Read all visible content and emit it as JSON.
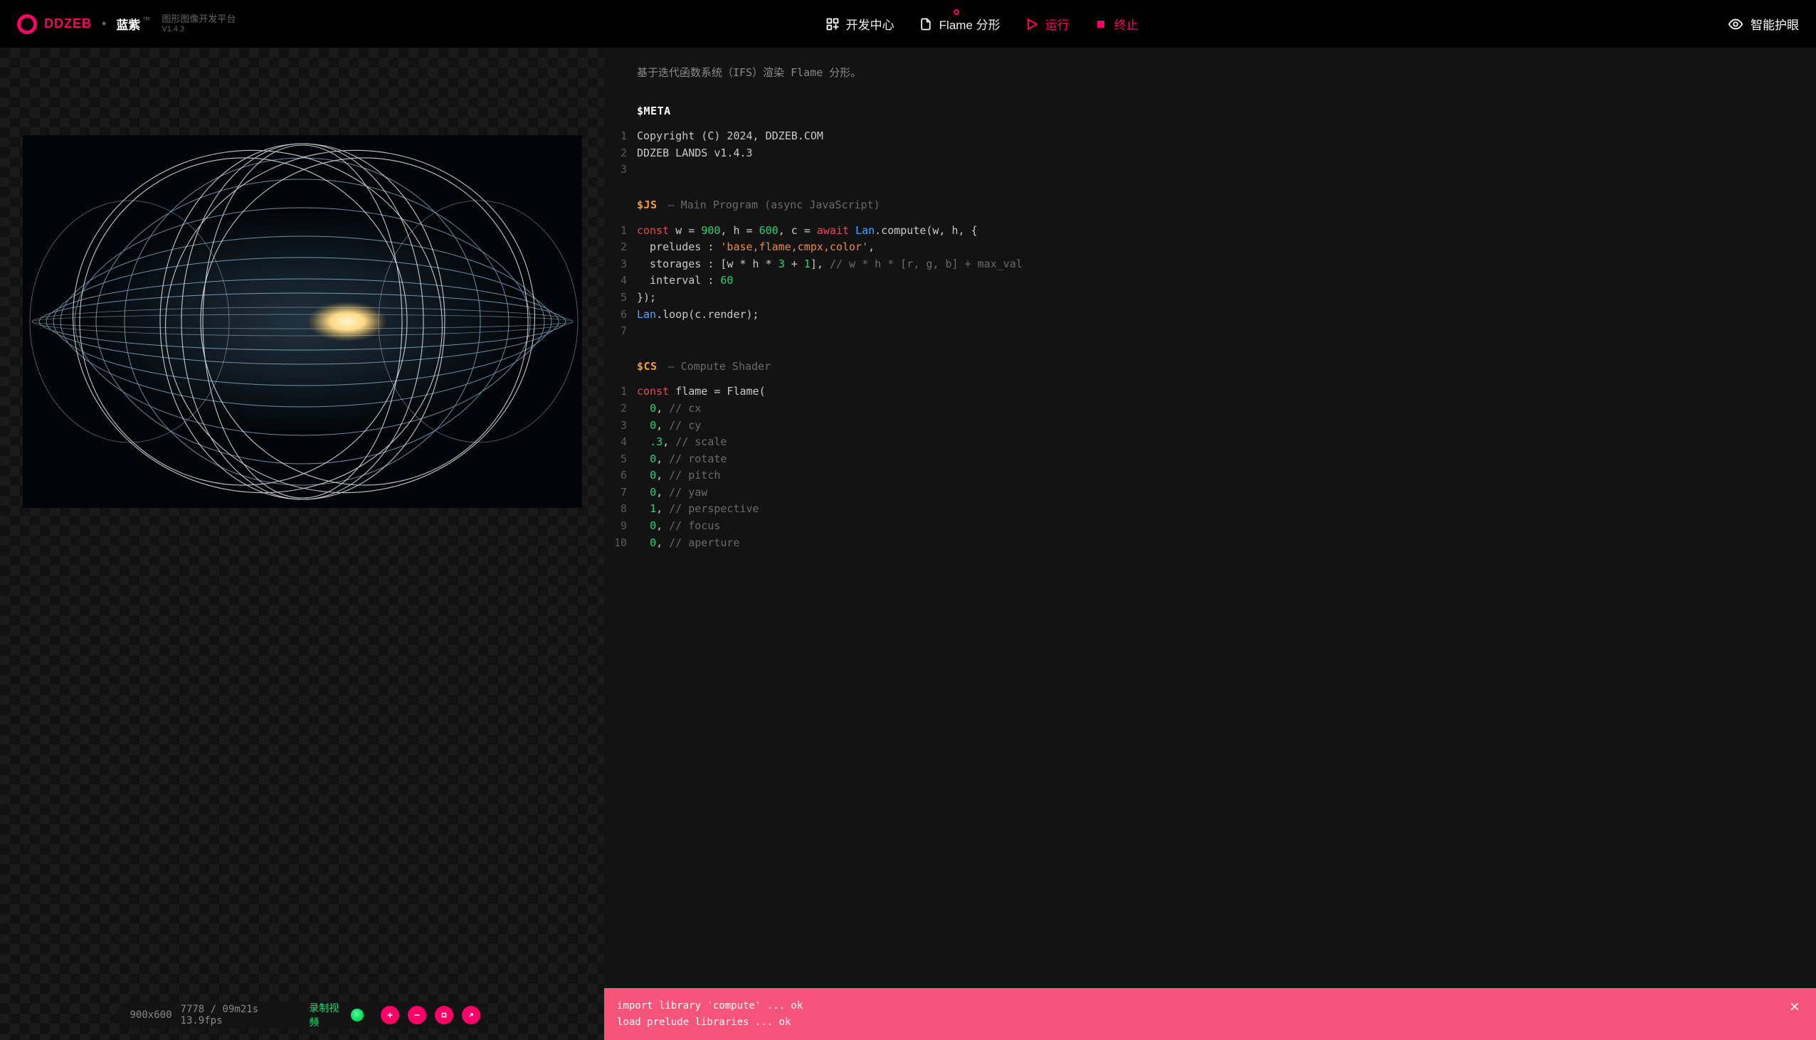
{
  "brand": {
    "name": "DDZEB",
    "sub_name": "蓝紫",
    "tm": "™",
    "desc": "图形图像开发平台",
    "version": "V1.4.3"
  },
  "header": {
    "dev_center": "开发中心",
    "file_label": "Flame 分形",
    "run": "运行",
    "stop": "终止",
    "eye_care": "智能护眼"
  },
  "status": {
    "resolution": "900x600",
    "frame": "7778",
    "time": "09m21s",
    "fps": "13.9fps",
    "record": "录制视频"
  },
  "editor": {
    "description": "基于迭代函数系统（IFS）渲染 Flame 分形。",
    "sections": {
      "meta": {
        "tag": "$META"
      },
      "js": {
        "tag": "$JS",
        "subtitle": "— Main Program (async JavaScript)"
      },
      "cs": {
        "tag": "$CS",
        "subtitle": "— Compute Shader"
      }
    },
    "meta_lines": [
      {
        "n": "1",
        "text": "Copyright (C) 2024, DDZEB.COM"
      },
      {
        "n": "2",
        "text": "DDZEB LANDS v1.4.3"
      },
      {
        "n": "3",
        "text": ""
      }
    ],
    "js_lines": [
      {
        "n": "1",
        "html": "<span class='tok-kw'>const</span> w = <span class='tok-num'>900</span>, h = <span class='tok-num'>600</span>, c = <span class='tok-await'>await</span> <span class='tok-fn'>Lan</span>.compute(w, h, {"
      },
      {
        "n": "2",
        "html": "  preludes : <span class='tok-str'>'base,flame,cmpx,color'</span>,"
      },
      {
        "n": "3",
        "html": "  storages : [w * h * <span class='tok-num'>3</span> + <span class='tok-num'>1</span>], <span class='tok-cm'>// w * h * [r, g, b] + max_val</span>"
      },
      {
        "n": "4",
        "html": "  interval : <span class='tok-num'>60</span>"
      },
      {
        "n": "5",
        "html": "});"
      },
      {
        "n": "6",
        "html": "<span class='tok-fn'>Lan</span>.loop(c.render);"
      },
      {
        "n": "7",
        "html": ""
      }
    ],
    "cs_lines": [
      {
        "n": "1",
        "html": "<span class='tok-kw'>const</span> flame = Flame("
      },
      {
        "n": "2",
        "html": "  <span class='tok-num'>0</span>, <span class='tok-cm'>// cx</span>"
      },
      {
        "n": "3",
        "html": "  <span class='tok-num'>0</span>, <span class='tok-cm'>// cy</span>"
      },
      {
        "n": "4",
        "html": "  <span class='tok-num'>.3</span>, <span class='tok-cm'>// scale</span>"
      },
      {
        "n": "5",
        "html": "  <span class='tok-num'>0</span>, <span class='tok-cm'>// rotate</span>"
      },
      {
        "n": "6",
        "html": "  <span class='tok-num'>0</span>, <span class='tok-cm'>// pitch</span>"
      },
      {
        "n": "7",
        "html": "  <span class='tok-num'>0</span>, <span class='tok-cm'>// yaw</span>"
      },
      {
        "n": "8",
        "html": "  <span class='tok-num'>1</span>, <span class='tok-cm'>// perspective</span>"
      },
      {
        "n": "9",
        "html": "  <span class='tok-num'>0</span>, <span class='tok-cm'>// focus</span>"
      },
      {
        "n": "10",
        "html": "  <span class='tok-num'>0</span>, <span class='tok-cm'>// aperture</span>"
      }
    ]
  },
  "console": {
    "lines": "import library 'compute' ... ok\nload prelude libraries ... ok"
  }
}
